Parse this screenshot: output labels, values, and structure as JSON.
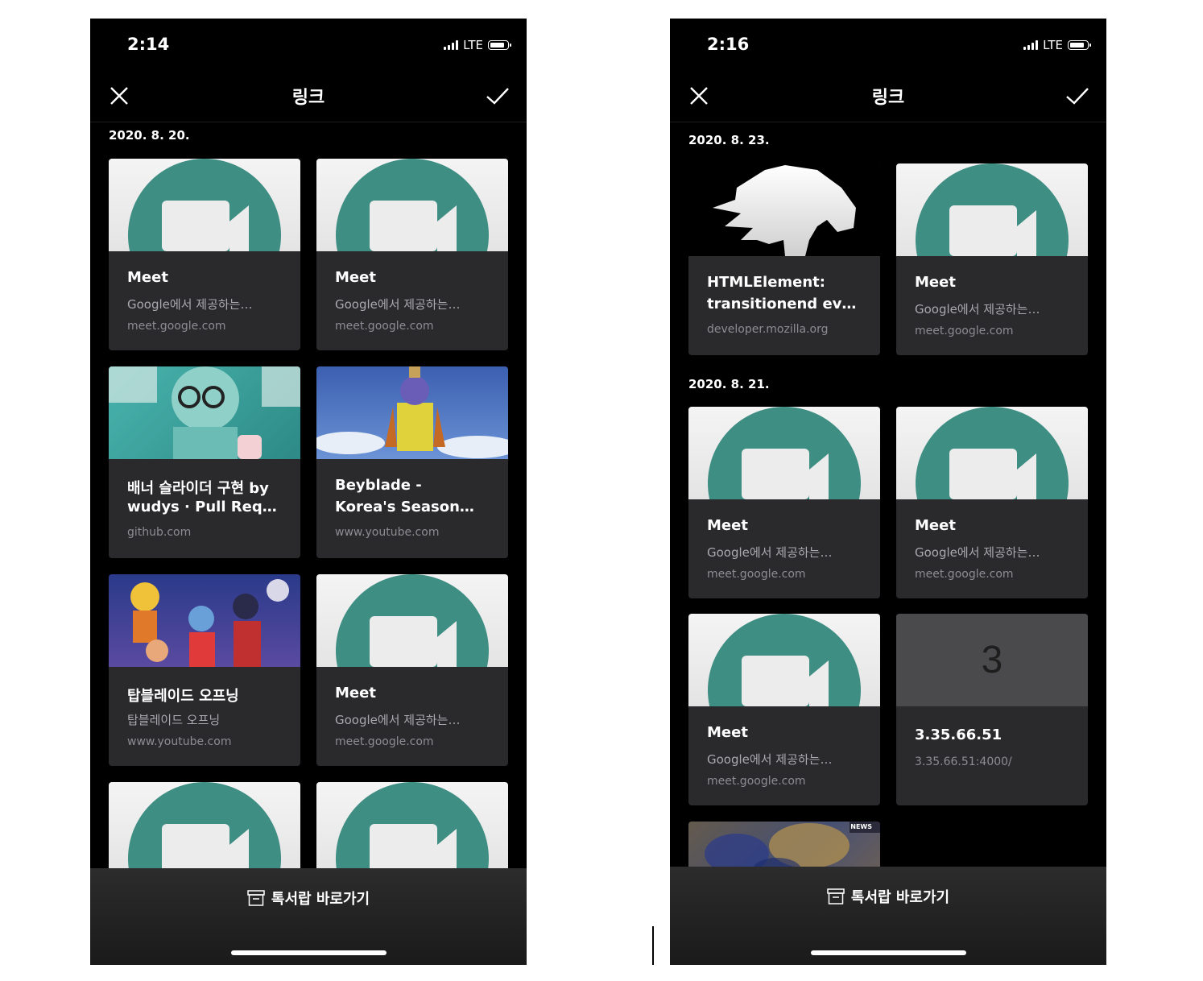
{
  "left": {
    "status": {
      "time": "2:14",
      "network": "LTE"
    },
    "nav": {
      "title": "링크"
    },
    "sections": [
      {
        "date": "2020. 8. 20."
      }
    ],
    "cards": [
      {
        "title": "Meet",
        "desc": "Google에서 제공하는…",
        "domain": "meet.google.com",
        "thumb": "meet"
      },
      {
        "title": "Meet",
        "desc": "Google에서 제공하는…",
        "domain": "meet.google.com",
        "thumb": "meet"
      },
      {
        "title1": "배너 슬라이더 구현 by",
        "title2": "wudys · Pull Req…",
        "domain": "github.com",
        "thumb": "baemin"
      },
      {
        "title1": "Beyblade -",
        "title2": "Korea's Season…",
        "domain": "www.youtube.com",
        "thumb": "beyblade"
      },
      {
        "title": "탑블레이드 오프닝",
        "desc": "탑블레이드 오프닝",
        "domain": "www.youtube.com",
        "thumb": "anime"
      },
      {
        "title": "Meet",
        "desc": "Google에서 제공하는…",
        "domain": "meet.google.com",
        "thumb": "meet"
      }
    ],
    "bottom": {
      "label": "톡서랍 바로가기"
    }
  },
  "right": {
    "status": {
      "time": "2:16",
      "network": "LTE"
    },
    "nav": {
      "title": "링크"
    },
    "sections": [
      {
        "date": "2020. 8. 23."
      },
      {
        "date": "2020. 8. 21."
      }
    ],
    "cards": [
      {
        "title1": "HTMLElement:",
        "title2": "transitionend ev…",
        "domain": "developer.mozilla.org",
        "thumb": "dino"
      },
      {
        "title": "Meet",
        "desc": "Google에서 제공하는…",
        "domain": "meet.google.com",
        "thumb": "meet"
      },
      {
        "title": "Meet",
        "desc": "Google에서 제공하는…",
        "domain": "meet.google.com",
        "thumb": "meet"
      },
      {
        "title": "Meet",
        "desc": "Google에서 제공하는…",
        "domain": "meet.google.com",
        "thumb": "meet"
      },
      {
        "title": "Meet",
        "desc": "Google에서 제공하는…",
        "domain": "meet.google.com",
        "thumb": "meet"
      },
      {
        "title": "3.35.66.51",
        "domain": "3.35.66.51:4000/",
        "thumb": "number",
        "thumb_text": "3"
      }
    ],
    "partial_thumb_badge": "NEWS",
    "bottom": {
      "label": "톡서랍 바로가기"
    }
  }
}
